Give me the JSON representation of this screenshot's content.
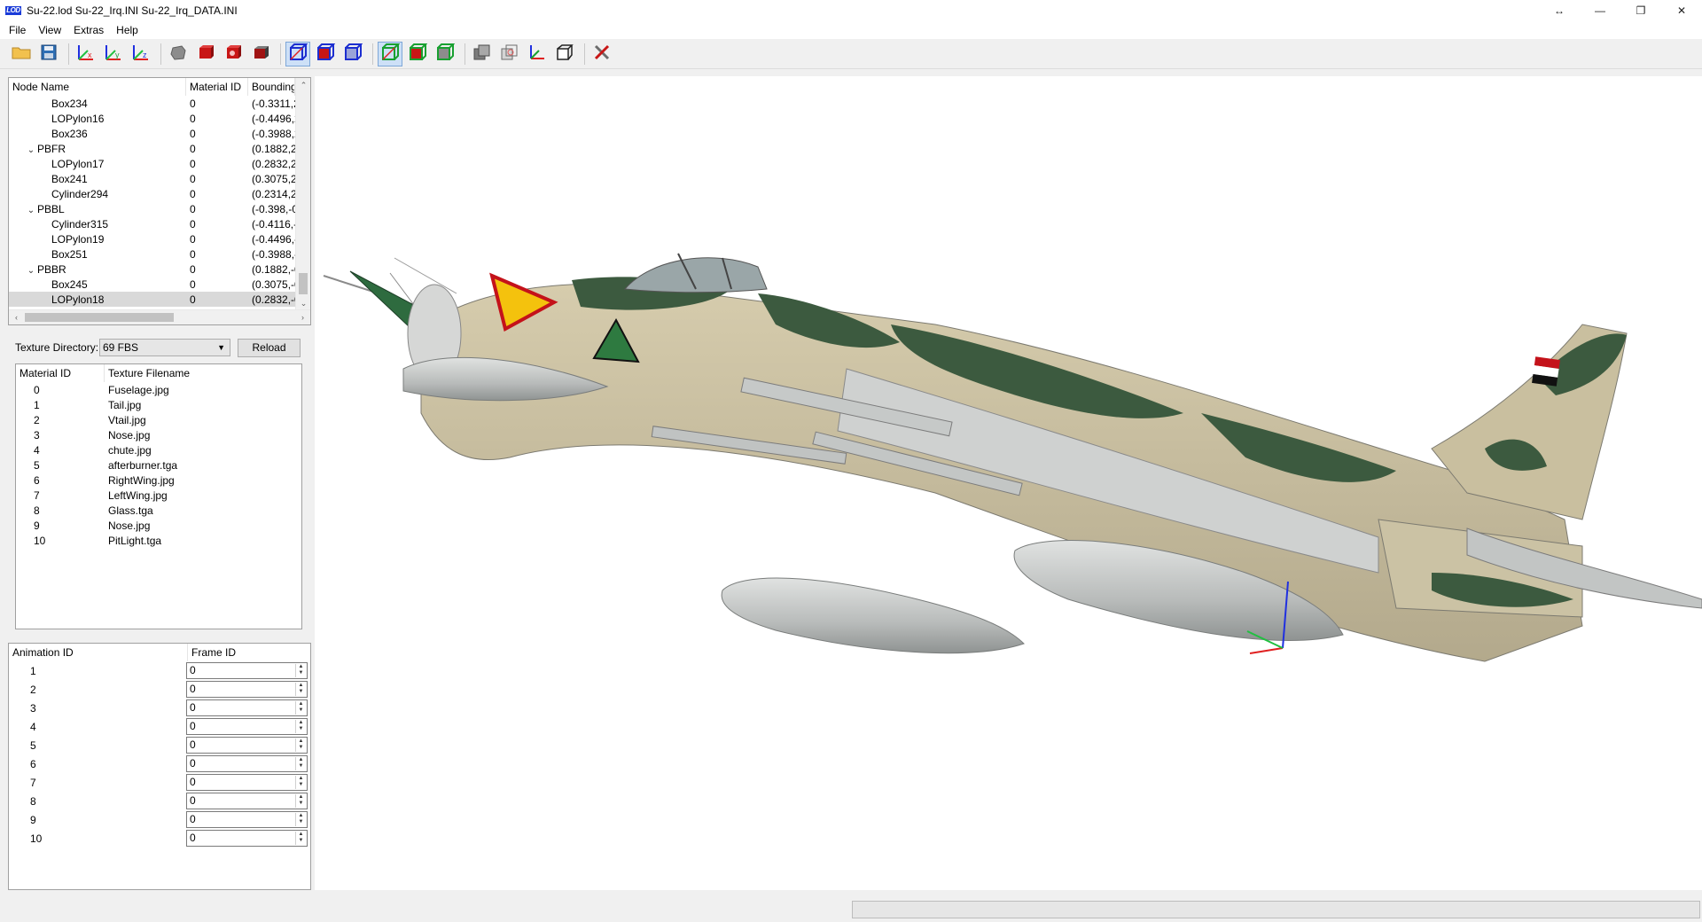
{
  "window": {
    "logo_text": "LOD",
    "title": "Su-22.lod  Su-22_Irq.INI  Su-22_Irq_DATA.INI",
    "controls": [
      "↔",
      "—",
      "❐",
      "✕"
    ]
  },
  "menu": [
    "File",
    "View",
    "Extras",
    "Help"
  ],
  "toolbar": {
    "buttons": [
      {
        "icon": "open-folder-icon",
        "checked": false
      },
      {
        "icon": "save-icon",
        "checked": false
      },
      {
        "icon": "rotate-x-axis-icon",
        "checked": false
      },
      {
        "icon": "rotate-y-axis-icon",
        "checked": false
      },
      {
        "icon": "rotate-z-axis-icon",
        "checked": false
      },
      {
        "icon": "smooth-shading-icon",
        "checked": false
      },
      {
        "icon": "solid-red-cube-icon",
        "checked": false
      },
      {
        "icon": "textured-cube-icon",
        "checked": false
      },
      {
        "icon": "dark-cube-icon",
        "checked": false
      },
      {
        "icon": "wireframe-cube-icon",
        "checked": true
      },
      {
        "icon": "solid-wire-cube-icon",
        "checked": false
      },
      {
        "icon": "bounding-box-icon",
        "checked": false
      },
      {
        "icon": "green-wire-cube-icon",
        "checked": true
      },
      {
        "icon": "green-solid-cube-icon",
        "checked": false
      },
      {
        "icon": "green-box-icon",
        "checked": false
      },
      {
        "icon": "grey-cube-icon",
        "checked": false
      },
      {
        "icon": "transparent-cube-icon",
        "checked": false
      },
      {
        "icon": "axes-icon",
        "checked": false
      },
      {
        "icon": "outline-cube-icon",
        "checked": false
      },
      {
        "icon": "tools-icon",
        "checked": false
      }
    ]
  },
  "node_tree": {
    "columns": [
      "Node Name",
      "Material ID",
      "Bounding"
    ],
    "rows": [
      {
        "name": "Box234",
        "material": "0",
        "bounding": "(-0.3311,2",
        "level": 2,
        "expander": ""
      },
      {
        "name": "LOPylon16",
        "material": "0",
        "bounding": "(-0.4496,2",
        "level": 2,
        "expander": ""
      },
      {
        "name": "Box236",
        "material": "0",
        "bounding": "(-0.3988,2",
        "level": 2,
        "expander": ""
      },
      {
        "name": "PBFR",
        "material": "0",
        "bounding": "(0.1882,2.",
        "level": 1,
        "expander": "⌄"
      },
      {
        "name": "LOPylon17",
        "material": "0",
        "bounding": "(0.2832,2.",
        "level": 2,
        "expander": ""
      },
      {
        "name": "Box241",
        "material": "0",
        "bounding": "(0.3075,2.",
        "level": 2,
        "expander": ""
      },
      {
        "name": "Cylinder294",
        "material": "0",
        "bounding": "(0.2314,2.",
        "level": 2,
        "expander": ""
      },
      {
        "name": "PBBL",
        "material": "0",
        "bounding": "(-0.398,-0",
        "level": 1,
        "expander": "⌄"
      },
      {
        "name": "Cylinder315",
        "material": "0",
        "bounding": "(-0.4116,-",
        "level": 2,
        "expander": ""
      },
      {
        "name": "LOPylon19",
        "material": "0",
        "bounding": "(-0.4496,-",
        "level": 2,
        "expander": ""
      },
      {
        "name": "Box251",
        "material": "0",
        "bounding": "(-0.3988,-",
        "level": 2,
        "expander": ""
      },
      {
        "name": "PBBR",
        "material": "0",
        "bounding": "(0.1882,-0",
        "level": 1,
        "expander": "⌄"
      },
      {
        "name": "Box245",
        "material": "0",
        "bounding": "(0.3075,-0",
        "level": 2,
        "expander": ""
      },
      {
        "name": "LOPylon18",
        "material": "0",
        "bounding": "(0.2832,-0",
        "level": 2,
        "expander": "",
        "selected": true
      }
    ]
  },
  "texture": {
    "dir_label": "Texture Directory:",
    "dir_value": "69 FBS",
    "reload_label": "Reload",
    "columns": [
      "Material ID",
      "Texture Filename"
    ],
    "rows": [
      {
        "id": "0",
        "file": "Fuselage.jpg"
      },
      {
        "id": "1",
        "file": "Tail.jpg"
      },
      {
        "id": "2",
        "file": "Vtail.jpg"
      },
      {
        "id": "3",
        "file": "Nose.jpg"
      },
      {
        "id": "4",
        "file": "chute.jpg"
      },
      {
        "id": "5",
        "file": "afterburner.tga"
      },
      {
        "id": "6",
        "file": "RightWing.jpg"
      },
      {
        "id": "7",
        "file": "LeftWing.jpg"
      },
      {
        "id": "8",
        "file": "Glass.tga"
      },
      {
        "id": "9",
        "file": "Nose.jpg"
      },
      {
        "id": "10",
        "file": "PitLight.tga"
      }
    ]
  },
  "animation": {
    "columns": [
      "Animation ID",
      "Frame ID"
    ],
    "rows": [
      {
        "id": "1",
        "frame": "0"
      },
      {
        "id": "2",
        "frame": "0"
      },
      {
        "id": "3",
        "frame": "0"
      },
      {
        "id": "4",
        "frame": "0"
      },
      {
        "id": "5",
        "frame": "0"
      },
      {
        "id": "6",
        "frame": "0"
      },
      {
        "id": "7",
        "frame": "0"
      },
      {
        "id": "8",
        "frame": "0"
      },
      {
        "id": "9",
        "frame": "0"
      },
      {
        "id": "10",
        "frame": "0"
      }
    ]
  },
  "status": {
    "progress": 0
  },
  "colors": {
    "camo_sand": "#cfc5a6",
    "camo_green": "#3c5a3f",
    "tank_grey": "#c4c7c6",
    "axis_x": "#e02020",
    "axis_y": "#20c040",
    "axis_z": "#2030e0"
  }
}
